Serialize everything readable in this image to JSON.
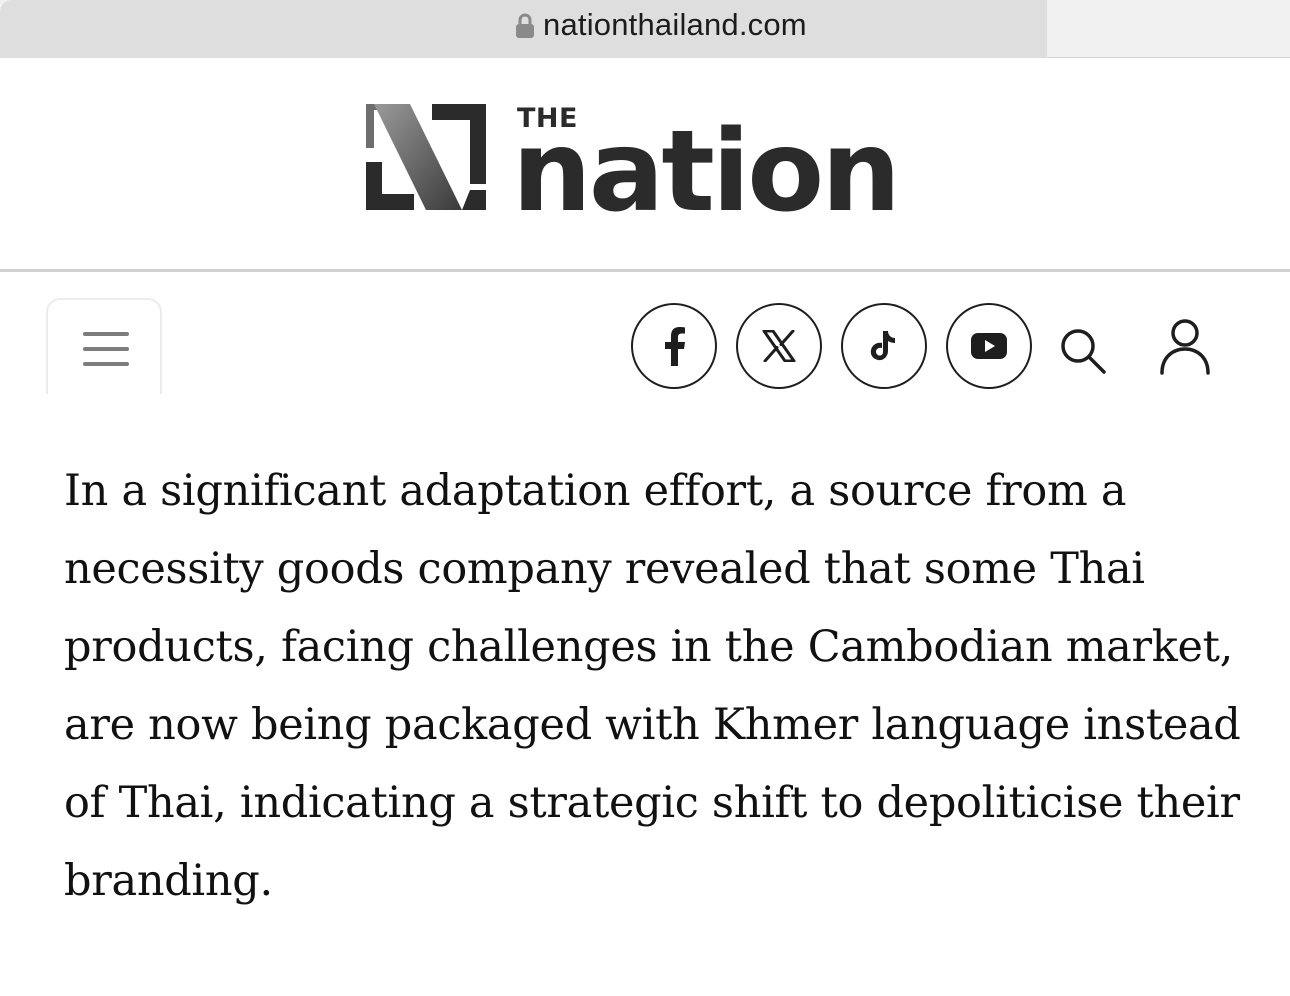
{
  "browser": {
    "url": "nationthailand.com",
    "lock_icon": "lock-icon"
  },
  "header": {
    "logo_prefix": "THE",
    "logo_word": "nation",
    "logo_icon": "n-logo-mark"
  },
  "nav": {
    "menu_icon": "hamburger-menu-icon",
    "social": [
      {
        "name": "facebook",
        "icon": "facebook-icon"
      },
      {
        "name": "x",
        "icon": "x-icon"
      },
      {
        "name": "tiktok",
        "icon": "tiktok-icon"
      },
      {
        "name": "youtube",
        "icon": "youtube-icon"
      }
    ],
    "search_icon": "search-icon",
    "user_icon": "user-icon"
  },
  "article": {
    "paragraph": "In a significant adaptation effort, a source from a necessity goods company revealed that some Thai products, facing challenges in the Cambodian market, are now being packaged with Khmer language instead of Thai, indicating a strategic shift to depoliticise their branding."
  },
  "colors": {
    "url_bar": "#dedede",
    "text": "#111111",
    "logo": "#2b2b2b",
    "rule": "#d0d0d0"
  }
}
